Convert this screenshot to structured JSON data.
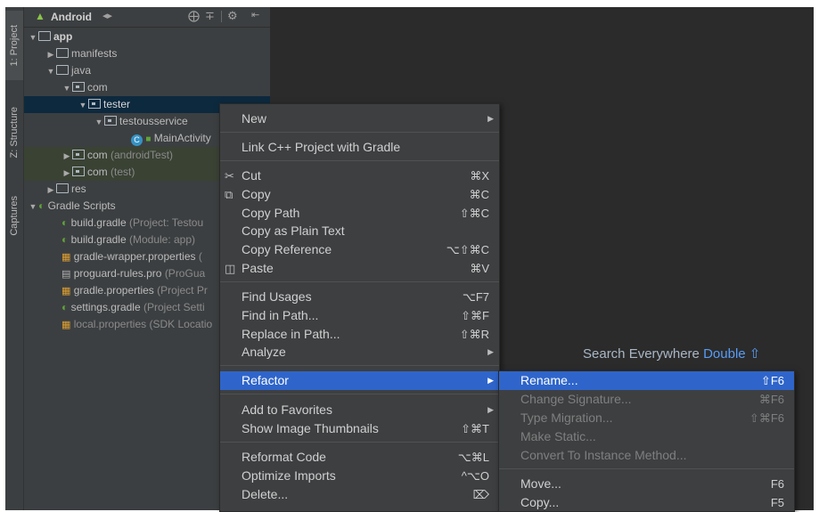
{
  "sidebar_tabs": [
    {
      "label": "1: Project",
      "icon": "android-icon"
    },
    {
      "label": "Z: Structure",
      "icon": "structure-icon"
    },
    {
      "label": "Captures",
      "icon": "captures-icon"
    }
  ],
  "panel_header": {
    "view_label": "Android",
    "icons": [
      "switch-view-icon",
      "target-icon",
      "collapse-icon",
      "gear-icon",
      "hide-icon"
    ]
  },
  "tree": [
    {
      "label": "app",
      "detail": ""
    },
    {
      "label": "manifests",
      "detail": ""
    },
    {
      "label": "java",
      "detail": ""
    },
    {
      "label": "com",
      "detail": ""
    },
    {
      "label": "tester",
      "detail": ""
    },
    {
      "label": "testousservice",
      "detail": ""
    },
    {
      "label": "MainActivity",
      "detail": ""
    },
    {
      "label": "com",
      "detail": "(androidTest)"
    },
    {
      "label": "com",
      "detail": "(test)"
    },
    {
      "label": "res",
      "detail": ""
    },
    {
      "label": "Gradle Scripts",
      "detail": ""
    },
    {
      "label": "build.gradle",
      "detail": "(Project: Testou"
    },
    {
      "label": "build.gradle",
      "detail": "(Module: app)"
    },
    {
      "label": "gradle-wrapper.properties",
      "detail": "("
    },
    {
      "label": "proguard-rules.pro",
      "detail": "(ProGua"
    },
    {
      "label": "gradle.properties",
      "detail": "(Project Pr"
    },
    {
      "label": "settings.gradle",
      "detail": "(Project Setti"
    },
    {
      "label": "local.properties",
      "detail": "(SDK Locatio"
    }
  ],
  "context_menu": {
    "new": {
      "label": "New"
    },
    "link_cpp": {
      "label": "Link C++ Project with Gradle"
    },
    "cut": {
      "label": "Cut",
      "shortcut": "⌘X"
    },
    "copy": {
      "label": "Copy",
      "shortcut": "⌘C"
    },
    "copy_path": {
      "label": "Copy Path",
      "shortcut": "⇧⌘C"
    },
    "copy_plain": {
      "label": "Copy as Plain Text"
    },
    "copy_ref": {
      "label": "Copy Reference",
      "shortcut": "⌥⇧⌘C"
    },
    "paste": {
      "label": "Paste",
      "shortcut": "⌘V"
    },
    "find_usages": {
      "label": "Find Usages",
      "shortcut": "⌥F7"
    },
    "find_in_path": {
      "label": "Find in Path...",
      "shortcut": "⇧⌘F"
    },
    "replace_in_path": {
      "label": "Replace in Path...",
      "shortcut": "⇧⌘R"
    },
    "analyze": {
      "label": "Analyze"
    },
    "refactor": {
      "label": "Refactor"
    },
    "add_favorites": {
      "label": "Add to Favorites"
    },
    "show_thumbnails": {
      "label": "Show Image Thumbnails",
      "shortcut": "⇧⌘T"
    },
    "reformat": {
      "label": "Reformat Code",
      "shortcut": "⌥⌘L"
    },
    "optimize": {
      "label": "Optimize Imports",
      "shortcut": "^⌥O"
    },
    "delete": {
      "label": "Delete...",
      "shortcut": "⌦"
    }
  },
  "refactor_submenu": {
    "rename": {
      "label": "Rename...",
      "shortcut": "⇧F6"
    },
    "change_signature": {
      "label": "Change Signature...",
      "shortcut": "⌘F6"
    },
    "type_migration": {
      "label": "Type Migration...",
      "shortcut": "⇧⌘F6"
    },
    "make_static": {
      "label": "Make Static..."
    },
    "convert_instance": {
      "label": "Convert To Instance Method..."
    },
    "move": {
      "label": "Move...",
      "shortcut": "F6"
    },
    "copy": {
      "label": "Copy...",
      "shortcut": "F5"
    }
  },
  "editor_hint": {
    "text": "Search Everywhere",
    "keys": "Double ⇧"
  },
  "colors": {
    "accent": "#2f65ca",
    "background": "#2b2b2b",
    "panel": "#3c3f41",
    "menu": "#3d3f41",
    "link": "#589df6"
  }
}
